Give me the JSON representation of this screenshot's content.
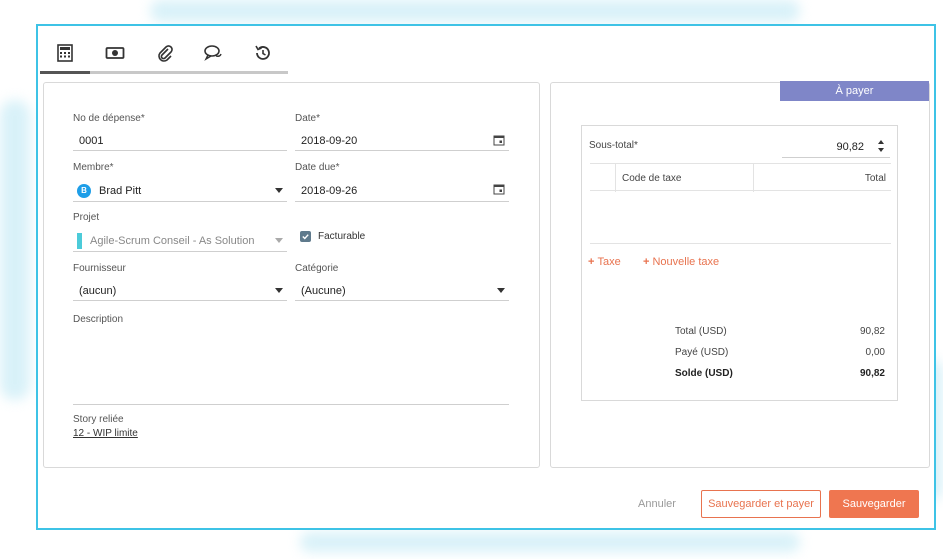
{
  "tabs": [
    {
      "icon": "calculator-icon"
    },
    {
      "icon": "money-icon"
    },
    {
      "icon": "paperclip-icon"
    },
    {
      "icon": "comments-icon"
    },
    {
      "icon": "history-icon"
    }
  ],
  "form": {
    "expense_no": {
      "label": "No de dépense*",
      "value": "0001"
    },
    "date": {
      "label": "Date*",
      "value": "2018-09-20"
    },
    "member": {
      "label": "Membre*",
      "value": "Brad Pitt",
      "avatar": "B"
    },
    "due_date": {
      "label": "Date due*",
      "value": "2018-09-26"
    },
    "project": {
      "label": "Projet",
      "value": "Agile-Scrum Conseil - As Solution"
    },
    "billable": {
      "label": "Facturable",
      "checked": true
    },
    "supplier": {
      "label": "Fournisseur",
      "value": "(aucun)"
    },
    "category": {
      "label": "Catégorie",
      "value": "(Aucune)"
    },
    "description": {
      "label": "Description",
      "value": ""
    },
    "story": {
      "label": "Story reliée",
      "link": "12 - WIP limite"
    }
  },
  "right": {
    "status": "À payer",
    "subtotal_label": "Sous-total*",
    "subtotal_value": "90,82",
    "tax_table": {
      "col_code": "Code de taxe",
      "col_total": "Total"
    },
    "add_tax": "Taxe",
    "new_tax": "Nouvelle taxe",
    "totals": [
      {
        "label": "Total (USD)",
        "value": "90,82",
        "bold": false
      },
      {
        "label": "Payé (USD)",
        "value": "0,00",
        "bold": false
      },
      {
        "label": "Solde (USD)",
        "value": "90,82",
        "bold": true
      }
    ]
  },
  "buttons": {
    "cancel": "Annuler",
    "save_and_pay": "Sauvegarder et payer",
    "save": "Sauvegarder"
  },
  "colors": {
    "accent": "#ef7650",
    "frame": "#3ec3e6",
    "status": "#7f86c8"
  }
}
